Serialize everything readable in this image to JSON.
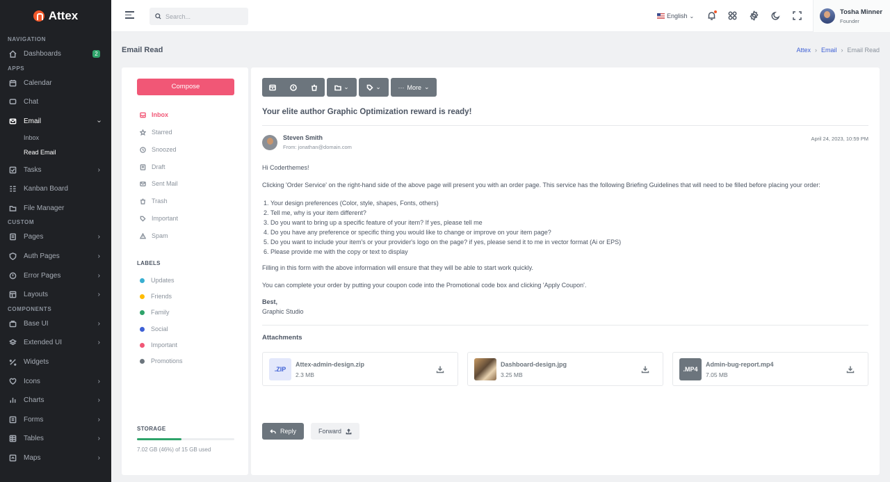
{
  "app": {
    "name": "Attex"
  },
  "sidebar": {
    "sections": {
      "navigation": "NAVIGATION",
      "apps": "APPS",
      "custom": "CUSTOM",
      "components": "COMPONENTS"
    },
    "dashboards": {
      "label": "Dashboards",
      "badge": "2"
    },
    "calendar": "Calendar",
    "chat": "Chat",
    "email": "Email",
    "email_sub": {
      "inbox": "Inbox",
      "read": "Read Email"
    },
    "tasks": "Tasks",
    "kanban": "Kanban Board",
    "file_manager": "File Manager",
    "pages": "Pages",
    "auth_pages": "Auth Pages",
    "error_pages": "Error Pages",
    "layouts": "Layouts",
    "base_ui": "Base UI",
    "extended_ui": "Extended UI",
    "widgets": "Widgets",
    "icons": "Icons",
    "charts": "Charts",
    "forms": "Forms",
    "tables": "Tables",
    "maps": "Maps"
  },
  "topbar": {
    "search_placeholder": "Search...",
    "language": "English",
    "user": {
      "name": "Tosha Minner",
      "role": "Founder"
    }
  },
  "page": {
    "title": "Email Read",
    "breadcrumb": [
      "Attex",
      "Email",
      "Email Read"
    ]
  },
  "mail_nav": {
    "compose": "Compose",
    "folders": [
      "Inbox",
      "Starred",
      "Snoozed",
      "Draft",
      "Sent Mail",
      "Trash",
      "Important",
      "Spam"
    ],
    "labels_title": "LABELS",
    "labels": [
      {
        "name": "Updates",
        "color": "#39afd1"
      },
      {
        "name": "Friends",
        "color": "#ffbc00"
      },
      {
        "name": "Family",
        "color": "#2ea36a"
      },
      {
        "name": "Social",
        "color": "#3e60d5"
      },
      {
        "name": "Important",
        "color": "#f15776"
      },
      {
        "name": "Promotions",
        "color": "#6c757d"
      }
    ],
    "storage_title": "STORAGE",
    "storage_percent": 46,
    "storage_text": "7.02 GB (46%) of 15 GB used"
  },
  "email": {
    "toolbar_more": "More",
    "subject": "Your elite author Graphic Optimization reward is ready!",
    "sender": "Steven Smith",
    "from": "From: jonathan@domain.com",
    "date": "April 24, 2023, 10:59 PM",
    "greeting": "Hi Coderthemes!",
    "para1": "Clicking 'Order Service' on the right-hand side of the above page will present you with an order page. This service has the following Briefing Guidelines that will need to be filled before placing your order:",
    "list": [
      "Your design preferences (Color, style, shapes, Fonts, others)",
      "Tell me, why is your item different?",
      "Do you want to bring up a specific feature of your item? If yes, please tell me",
      "Do you have any preference or specific thing you would like to change or improve on your item page?",
      "Do you want to include your item's or your provider's logo on the page? if yes, please send it to me in vector format (Ai or EPS)",
      "Please provide me with the copy or text to display"
    ],
    "para2": "Filling in this form with the above information will ensure that they will be able to start work quickly.",
    "para3": "You can complete your order by putting your coupon code into the Promotional code box and clicking 'Apply Coupon'.",
    "closing": "Best,",
    "signature": "Graphic Studio",
    "attachments_title": "Attachments",
    "attachments": [
      {
        "ext": ".ZIP",
        "name": "Attex-admin-design.zip",
        "size": "2.3 MB"
      },
      {
        "ext": "",
        "name": "Dashboard-design.jpg",
        "size": "3.25 MB"
      },
      {
        "ext": ".MP4",
        "name": "Admin-bug-report.mp4",
        "size": "7.05 MB"
      }
    ],
    "reply": "Reply",
    "forward": "Forward"
  }
}
